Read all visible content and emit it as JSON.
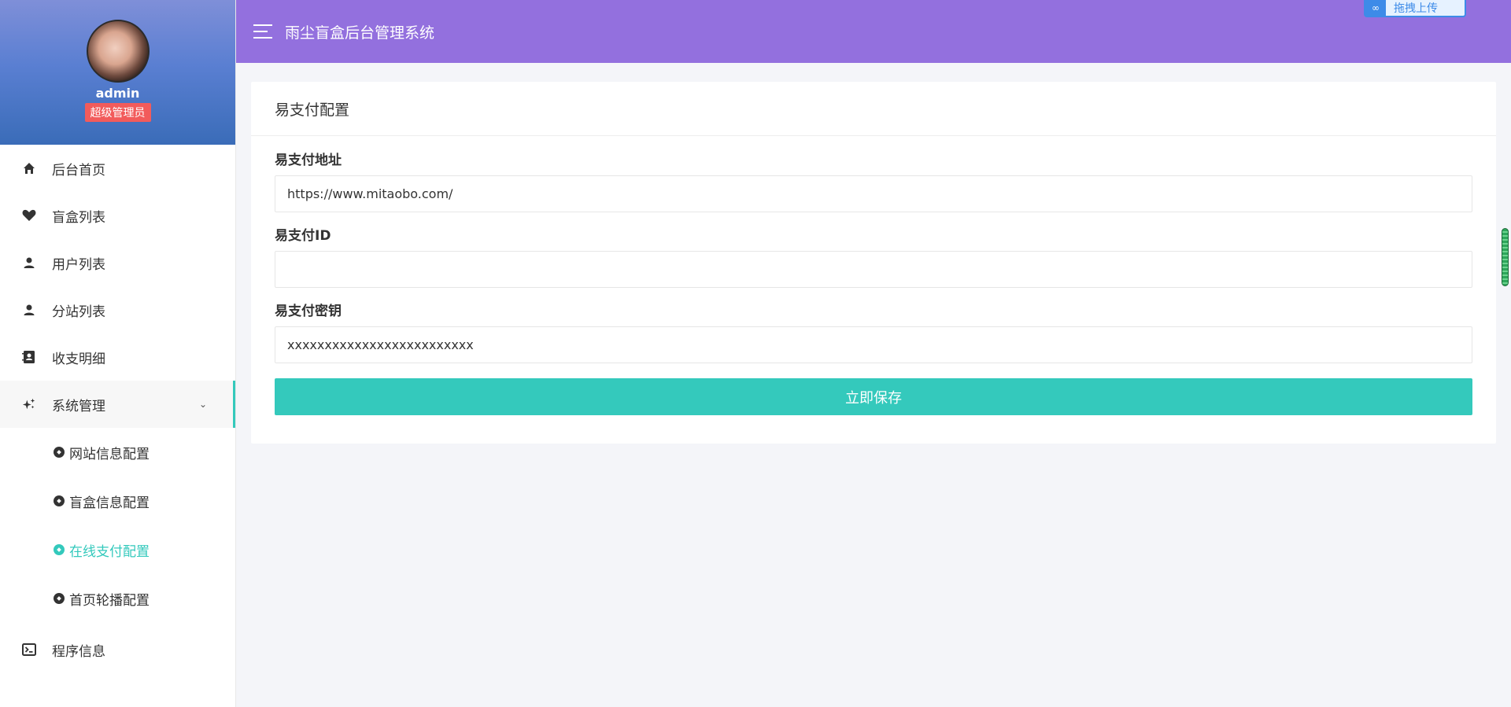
{
  "app": {
    "title": "雨尘盲盒后台管理系统"
  },
  "user": {
    "name": "admin",
    "role": "超级管理员"
  },
  "upload_widget": {
    "label": "拖拽上传"
  },
  "sidebar": {
    "items": [
      {
        "label": "后台首页",
        "icon": "home-icon"
      },
      {
        "label": "盲盒列表",
        "icon": "heart-icon"
      },
      {
        "label": "用户列表",
        "icon": "user-icon"
      },
      {
        "label": "分站列表",
        "icon": "user-icon"
      },
      {
        "label": "收支明细",
        "icon": "contacts-icon"
      },
      {
        "label": "系统管理",
        "icon": "sparkle-icon",
        "expanded": true
      }
    ],
    "submenu": [
      {
        "label": "网站信息配置",
        "active": false
      },
      {
        "label": "盲盒信息配置",
        "active": false
      },
      {
        "label": "在线支付配置",
        "active": true
      },
      {
        "label": "首页轮播配置",
        "active": false
      }
    ],
    "last_item": {
      "label": "程序信息",
      "icon": "terminal-icon"
    }
  },
  "card": {
    "title": "易支付配置",
    "fields": [
      {
        "label": "易支付地址",
        "value": "https://www.mitaobo.com/"
      },
      {
        "label": "易支付ID",
        "value": ""
      },
      {
        "label": "易支付密钥",
        "value": "xxxxxxxxxxxxxxxxxxxxxxxxx"
      }
    ],
    "save_label": "立即保存"
  },
  "colors": {
    "header": "#9370de",
    "accent": "#34c9bc",
    "badge": "#f25b5b"
  }
}
